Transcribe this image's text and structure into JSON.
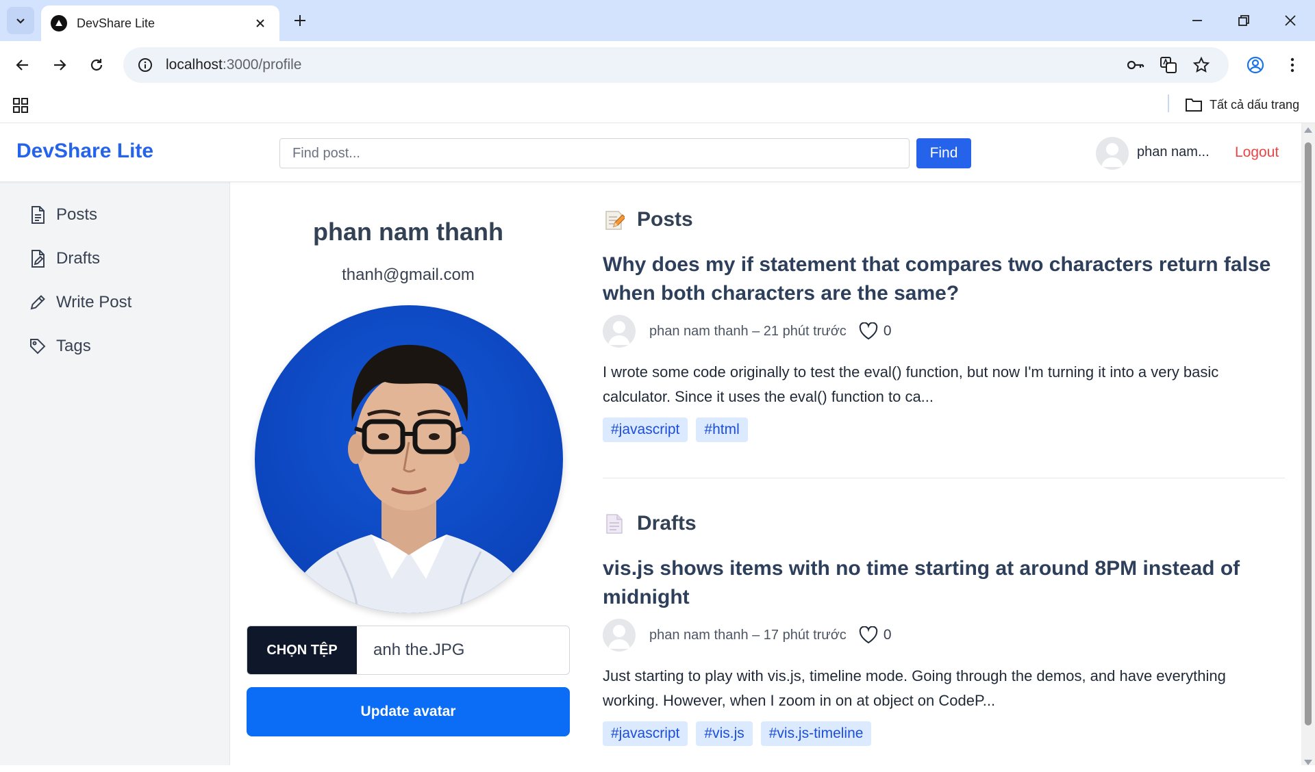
{
  "browser": {
    "tab_title": "DevShare Lite",
    "url_host": "localhost",
    "url_rest": ":3000/profile",
    "bookmarks_label": "Tất cả dấu trang"
  },
  "header": {
    "brand": "DevShare Lite",
    "search_placeholder": "Find post...",
    "find_label": "Find",
    "user_short": "phan nam...",
    "logout_label": "Logout"
  },
  "sidebar": {
    "items": [
      {
        "label": "Posts",
        "icon": "file-icon"
      },
      {
        "label": "Drafts",
        "icon": "draft-icon"
      },
      {
        "label": "Write Post",
        "icon": "pencil-icon"
      },
      {
        "label": "Tags",
        "icon": "tag-icon"
      }
    ]
  },
  "profile": {
    "name": "phan nam thanh",
    "email": "thanh@gmail.com",
    "choose_file_label": "CHỌN TỆP",
    "file_name": "anh the.JPG",
    "update_label": "Update avatar"
  },
  "posts_section": {
    "heading": "Posts",
    "items": [
      {
        "title": "Why does my if statement that compares two characters return false when both characters are the same?",
        "meta": "phan nam thanh – 21 phút trước",
        "likes": "0",
        "excerpt": "I wrote some code originally to test the eval() function, but now I'm turning it into a very basic calculator. Since it uses the eval() function to ca...",
        "tags": [
          "#javascript",
          "#html"
        ]
      }
    ]
  },
  "drafts_section": {
    "heading": "Drafts",
    "items": [
      {
        "title": "vis.js shows items with no time starting at around 8PM instead of midnight",
        "meta": "phan nam thanh – 17 phút trước",
        "likes": "0",
        "excerpt": "Just starting to play with vis.js, timeline mode. Going through the demos, and have everything working. However, when I zoom in on at object on CodeP...",
        "tags": [
          "#javascript",
          "#vis.js",
          "#vis.js-timeline"
        ]
      }
    ]
  },
  "colors": {
    "brand": "#2563eb",
    "logout": "#ef4444",
    "update_button": "#0b6cf5",
    "tag_bg": "#dbeafe",
    "tag_text": "#1d4ed8"
  }
}
